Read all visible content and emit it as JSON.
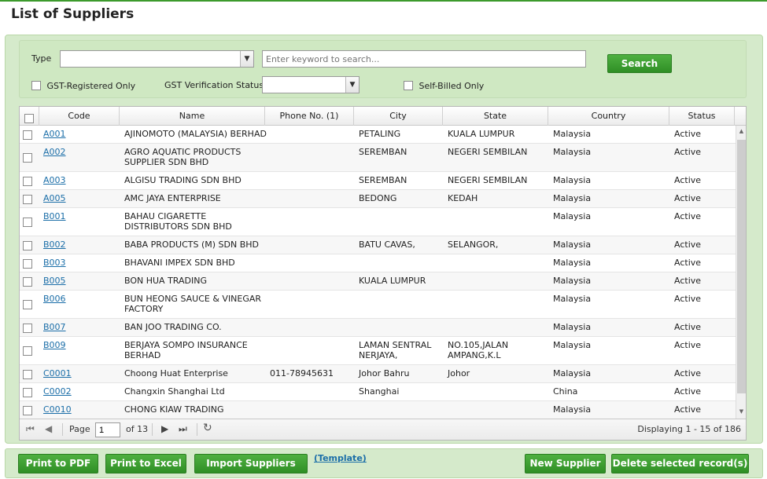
{
  "page": {
    "title": "List of Suppliers"
  },
  "filters": {
    "type_label": "Type",
    "type_value": "",
    "search_placeholder": "Enter keyword to search...",
    "search_button": "Search",
    "gst_registered_label": "GST-Registered Only",
    "gst_verification_label": "GST Verification Status",
    "gst_verification_value": "",
    "self_billed_label": "Self-Billed Only"
  },
  "table": {
    "headers": {
      "code": "Code",
      "name": "Name",
      "phone": "Phone No. (1)",
      "city": "City",
      "state": "State",
      "country": "Country",
      "status": "Status"
    },
    "rows": [
      {
        "code": "A001",
        "name1": "AJINOMOTO (MALAYSIA) BERHAD",
        "name2": "",
        "phone": "",
        "city1": "PETALING",
        "city2": "",
        "state1": "KUALA LUMPUR",
        "state2": "",
        "country": "Malaysia",
        "status": "Active"
      },
      {
        "code": "A002",
        "name1": "AGRO AQUATIC PRODUCTS",
        "name2": "SUPPLIER SDN BHD",
        "phone": "",
        "city1": "SEREMBAN",
        "city2": "",
        "state1": "NEGERI SEMBILAN",
        "state2": "",
        "country": "Malaysia",
        "status": "Active"
      },
      {
        "code": "A003",
        "name1": "ALGISU TRADING SDN BHD",
        "name2": "",
        "phone": "",
        "city1": "SEREMBAN",
        "city2": "",
        "state1": "NEGERI SEMBILAN",
        "state2": "",
        "country": "Malaysia",
        "status": "Active"
      },
      {
        "code": "A005",
        "name1": "AMC JAYA ENTERPRISE",
        "name2": "",
        "phone": "",
        "city1": "BEDONG",
        "city2": "",
        "state1": "KEDAH",
        "state2": "",
        "country": "Malaysia",
        "status": "Active"
      },
      {
        "code": "B001",
        "name1": "BAHAU CIGARETTE",
        "name2": "DISTRIBUTORS SDN BHD",
        "phone": "",
        "city1": "",
        "city2": "",
        "state1": "",
        "state2": "",
        "country": "Malaysia",
        "status": "Active"
      },
      {
        "code": "B002",
        "name1": "BABA PRODUCTS (M) SDN BHD",
        "name2": "",
        "phone": "",
        "city1": "BATU CAVAS,",
        "city2": "",
        "state1": "SELANGOR,",
        "state2": "",
        "country": "Malaysia",
        "status": "Active"
      },
      {
        "code": "B003",
        "name1": "BHAVANI IMPEX SDN BHD",
        "name2": "",
        "phone": "",
        "city1": "",
        "city2": "",
        "state1": "",
        "state2": "",
        "country": "Malaysia",
        "status": "Active"
      },
      {
        "code": "B005",
        "name1": "BON HUA TRADING",
        "name2": "",
        "phone": "",
        "city1": "KUALA LUMPUR",
        "city2": "",
        "state1": "",
        "state2": "",
        "country": "Malaysia",
        "status": "Active"
      },
      {
        "code": "B006",
        "name1": "BUN HEONG SAUCE & VINEGAR",
        "name2": "FACTORY",
        "phone": "",
        "city1": "",
        "city2": "",
        "state1": "",
        "state2": "",
        "country": "Malaysia",
        "status": "Active"
      },
      {
        "code": "B007",
        "name1": "BAN JOO TRADING CO.",
        "name2": "",
        "phone": "",
        "city1": "",
        "city2": "",
        "state1": "",
        "state2": "",
        "country": "Malaysia",
        "status": "Active"
      },
      {
        "code": "B009",
        "name1": "BERJAYA SOMPO INSURANCE",
        "name2": "BERHAD",
        "phone": "",
        "city1": "LAMAN SENTRAL",
        "city2": "NERJAYA,",
        "state1": "NO.105,JALAN",
        "state2": "AMPANG,K.L",
        "country": "Malaysia",
        "status": "Active"
      },
      {
        "code": "C0001",
        "name1": "Choong Huat Enterprise",
        "name2": "",
        "phone": "011-78945631",
        "city1": "Johor Bahru",
        "city2": "",
        "state1": "Johor",
        "state2": "",
        "country": "Malaysia",
        "status": "Active"
      },
      {
        "code": "C0002",
        "name1": "Changxin Shanghai Ltd",
        "name2": "",
        "phone": "",
        "city1": "Shanghai",
        "city2": "",
        "state1": "",
        "state2": "",
        "country": "China",
        "status": "Active"
      },
      {
        "code": "C0010",
        "name1": "CHONG KIAW TRADING",
        "name2": "",
        "phone": "",
        "city1": "",
        "city2": "",
        "state1": "",
        "state2": "",
        "country": "Malaysia",
        "status": "Active"
      }
    ]
  },
  "pager": {
    "page_label": "Page",
    "page_value": "1",
    "of_label": "of 13",
    "display_text": "Displaying 1 - 15 of 186"
  },
  "footer": {
    "print_pdf": "Print to PDF",
    "print_excel": "Print to Excel",
    "import": "Import Suppliers",
    "template": "(Template)",
    "new_supplier": "New Supplier",
    "delete_selected": "Delete selected record(s)"
  },
  "colors": {
    "accent": "#3c9a2c",
    "panel": "#d5eacb",
    "link": "#1b6ea8"
  }
}
